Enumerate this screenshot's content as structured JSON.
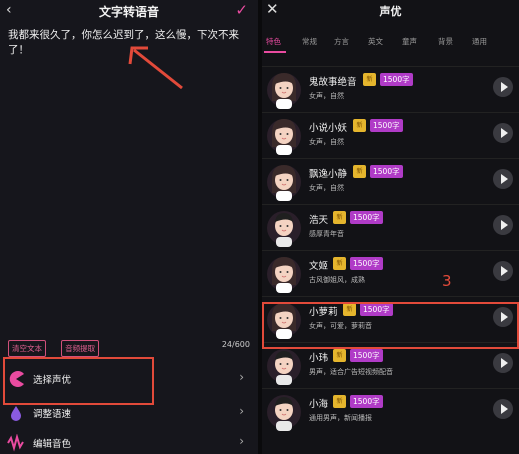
{
  "left_panel": {
    "back_icon": "back-chevron-icon",
    "title": "文字转语音",
    "confirm_icon": "check-icon",
    "text_content": "我都来很久了，你怎么迟到了，这么慢，下次不来了！",
    "clear_label": "清空文本",
    "extract_label": "音频提取",
    "char_count": "24/600",
    "menu": [
      {
        "label": "选择声优",
        "icon": "pacman-voice-icon"
      },
      {
        "label": "调整语速",
        "icon": "speed-drop-icon"
      },
      {
        "label": "编辑音色",
        "icon": "waveform-icon"
      }
    ]
  },
  "right_panel": {
    "close_icon": "close-icon",
    "title": "声优",
    "tabs": [
      "特色",
      "常规",
      "方言",
      "英文",
      "童声",
      "背景",
      "通用"
    ],
    "active_tab": 0,
    "step_number": "3",
    "voices": [
      {
        "name": "鬼故事绝音",
        "desc": "女声，自然",
        "badge": "新",
        "count": "1500字",
        "gender": "female"
      },
      {
        "name": "小说小妖",
        "desc": "女声，自然",
        "badge": "新",
        "count": "1500字",
        "gender": "female"
      },
      {
        "name": "飘逸小静",
        "desc": "女声，自然",
        "badge": "新",
        "count": "1500字",
        "gender": "female"
      },
      {
        "name": "浩天",
        "desc": "感厚青年音",
        "badge": "新",
        "count": "1500字",
        "gender": "male"
      },
      {
        "name": "文姬",
        "desc": "古风御姐风，成熟",
        "badge": "新",
        "count": "1500字",
        "gender": "female"
      },
      {
        "name": "小萝莉",
        "desc": "女声，可爱，萝莉音",
        "badge": "新",
        "count": "1500字",
        "gender": "female"
      },
      {
        "name": "小玮",
        "desc": "男声，适合广告短视频配音",
        "badge": "新",
        "count": "1500字",
        "gender": "male"
      },
      {
        "name": "小海",
        "desc": "通用男声，新闻播报",
        "badge": "新",
        "count": "1500字",
        "gender": "male"
      }
    ]
  },
  "colors": {
    "accent": "#e94ba0",
    "highlight_red": "#e24a3a",
    "badge_gold": "#e5b52d",
    "badge_purple": "#b03bc7"
  }
}
